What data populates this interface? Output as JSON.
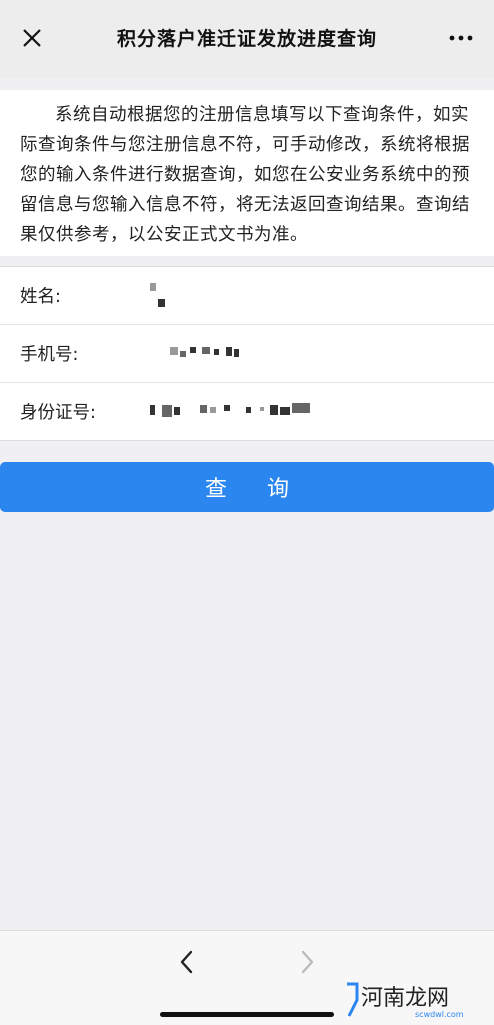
{
  "header": {
    "title": "积分落户准迁证发放进度查询",
    "close_icon": "close-icon",
    "more_icon": "more-icon"
  },
  "notice": {
    "text": "系统自动根据您的注册信息填写以下查询条件，如实际查询条件与您注册信息不符，可手动修改，系统将根据您的输入条件进行数据查询，如您在公安业务系统中的预留信息与您输入信息不符，将无法返回查询结果。查询结果仅供参考，以公安正式文书为准。"
  },
  "form": {
    "name_label": "姓名:",
    "phone_label": "手机号:",
    "id_label": "身份证号:"
  },
  "actions": {
    "query_label": "查询"
  },
  "footer": {
    "back_icon": "chevron-left-icon",
    "forward_icon": "chevron-right-icon"
  },
  "watermark": {
    "text": "河南龙网",
    "sub": "scwdwl.com"
  }
}
